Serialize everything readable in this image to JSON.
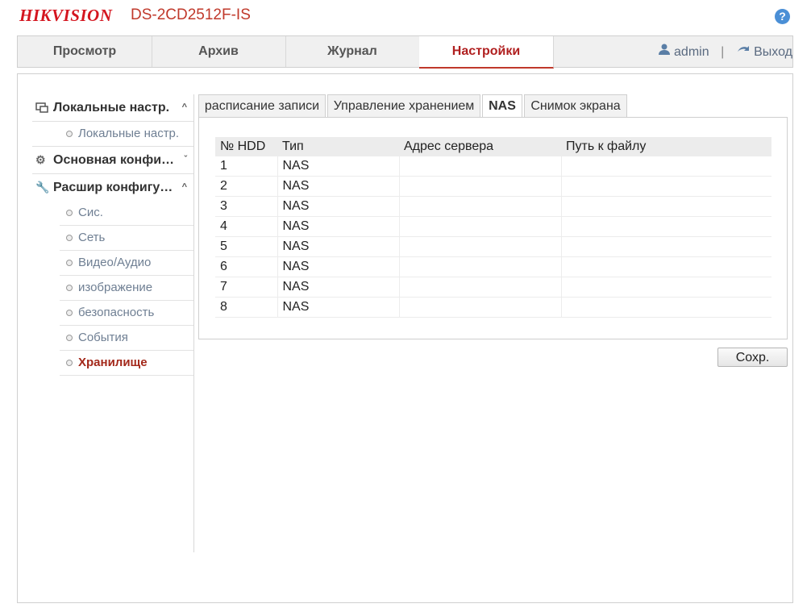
{
  "header": {
    "logo_hik": "HIK",
    "logo_vision": "VISION",
    "model": "DS-2CD2512F-IS",
    "help_icon": "?"
  },
  "nav": {
    "tabs": [
      {
        "label": "Просмотр"
      },
      {
        "label": "Архив"
      },
      {
        "label": "Журнал"
      },
      {
        "label": "Настройки"
      }
    ],
    "user": "admin",
    "separator": "|",
    "logout": "Выход"
  },
  "sidebar": {
    "local": {
      "label": "Локальные настр.",
      "items": [
        "Локальные настр."
      ]
    },
    "basic": {
      "label": "Основная конфи…"
    },
    "advanced": {
      "label": "Расшир конфигу…",
      "items": [
        "Сис.",
        "Сеть",
        "Видео/Аудио",
        "изображение",
        "безопасность",
        "События",
        "Хранилище"
      ]
    }
  },
  "subtabs": [
    {
      "label": "расписание записи"
    },
    {
      "label": "Управление хранением"
    },
    {
      "label": "NAS"
    },
    {
      "label": "Снимок экрана"
    }
  ],
  "table": {
    "headers": [
      "№ HDD",
      "Тип",
      "Адрес сервера",
      "Путь к файлу"
    ],
    "rows": [
      [
        "1",
        "NAS",
        "",
        ""
      ],
      [
        "2",
        "NAS",
        "",
        ""
      ],
      [
        "3",
        "NAS",
        "",
        ""
      ],
      [
        "4",
        "NAS",
        "",
        ""
      ],
      [
        "5",
        "NAS",
        "",
        ""
      ],
      [
        "6",
        "NAS",
        "",
        ""
      ],
      [
        "7",
        "NAS",
        "",
        ""
      ],
      [
        "8",
        "NAS",
        "",
        ""
      ]
    ]
  },
  "save_label": "Сохр.",
  "colors": {
    "accent": "#c0392b",
    "logo": "#d4151f",
    "link": "#6f7f93"
  }
}
